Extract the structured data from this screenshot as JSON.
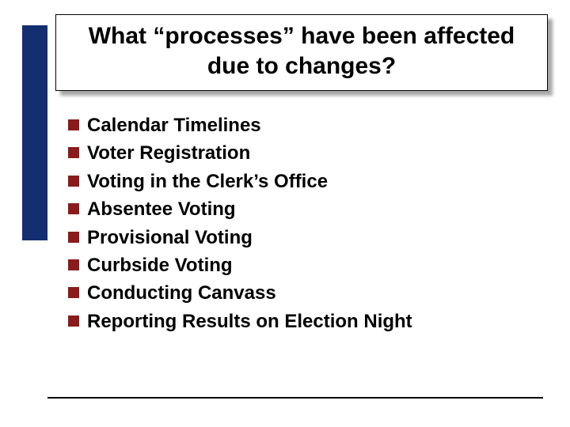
{
  "title": "What “processes” have been affected due to changes?",
  "bullets": [
    "Calendar Timelines",
    "Voter Registration",
    "Voting in the Clerk’s Office",
    "Absentee Voting",
    "Provisional Voting",
    "Curbside Voting",
    "Conducting Canvass",
    "Reporting Results on Election Night"
  ],
  "colors": {
    "sidebar": "#132f72",
    "bullet": "#8b1a1a"
  }
}
